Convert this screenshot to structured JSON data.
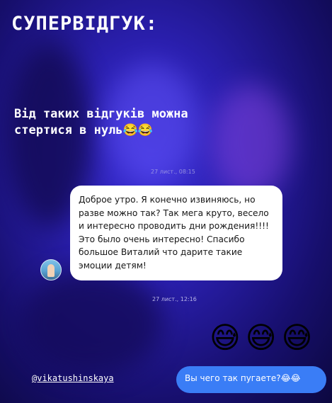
{
  "story": {
    "title": "СУПЕРВІДГУК:",
    "caption": "Від таких відгуків можна стертися в нуль😂😂",
    "username": "@vikatushinskaya"
  },
  "chat": {
    "timestamp_top": "27 лист., 08:15",
    "incoming_message": "Доброе утро. Я конечно извиняюсь, но разве можно так? Так мега круто, весело и интересно проводить дни рождения!!!! Это было очень интересно! Спасибо большое Виталий что дарите такие эмоции детям!",
    "timestamp": "27 лист., 12:16",
    "reaction_emojis": [
      "😅",
      "😅",
      "😅"
    ],
    "outgoing_message": "Вы чего так пугаете?😂😂"
  },
  "colors": {
    "background": "#2a1fae",
    "incoming_bubble": "#ffffff",
    "outgoing_bubble": "#3a7df6"
  },
  "icons": {
    "avatar": "sender-avatar"
  }
}
